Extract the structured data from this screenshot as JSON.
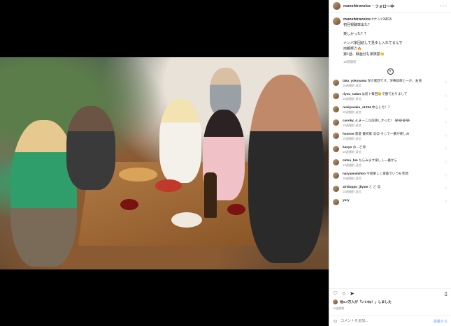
{
  "post": {
    "photo_alt": "photo",
    "account": "munehirovoice",
    "follow_label": "フォロー中",
    "caption_lines": [
      "#ナンバMG5",
      "初回視聴率出た？",
      "楽しかった？？",
      "ナンバ家団結して見ゆし入れてるんで",
      "両親努力🔥",
      "第1話、録画分も家族揃👏"
    ],
    "caption_time": "18週間前",
    "comments": [
      {
        "user": "taka_yokoyama",
        "text": "深さ家団です。深事録率と一か、右道",
        "meta": "18週間前 返信"
      },
      {
        "user": "riyou_tadan",
        "text": "は初ト毎回☺️で勝ておりまして",
        "meta": "18週間前 返信"
      },
      {
        "user": "ramlyesaku_s1234",
        "text": "中心した！？",
        "meta": "18週間前 返信"
      },
      {
        "user": "canoky_4_ji",
        "text": "一こ以前感しかった！\n😂😂😂😂",
        "meta": "18週間前 返信"
      },
      {
        "user": "honnos",
        "text": "家庭 最初家 😍😍\nそして一番が楽しみ",
        "meta": "18週間前 返信"
      },
      {
        "user": "kaoyo",
        "text": "お…ど😍",
        "meta": "18週間前 返信"
      },
      {
        "user": "mitsu_hm",
        "text": "ちらみます楽しし一番から",
        "meta": "18週間前 返信"
      },
      {
        "user": "naryamadahiro",
        "text": "今回楽しく家族でいつも笑顔",
        "meta": "18週間前 返信"
      },
      {
        "user": "airidoppo_jkyam",
        "text": "と ど 😍",
        "meta": "18週間前 返信"
      },
      {
        "user": "yury",
        "text": "",
        "meta": ""
      }
    ],
    "likes_text": "他1.7万人が「いいね！」しました",
    "post_date": "18週間前",
    "comment_placeholder": "コメントを追加...",
    "post_button": "投稿する"
  }
}
